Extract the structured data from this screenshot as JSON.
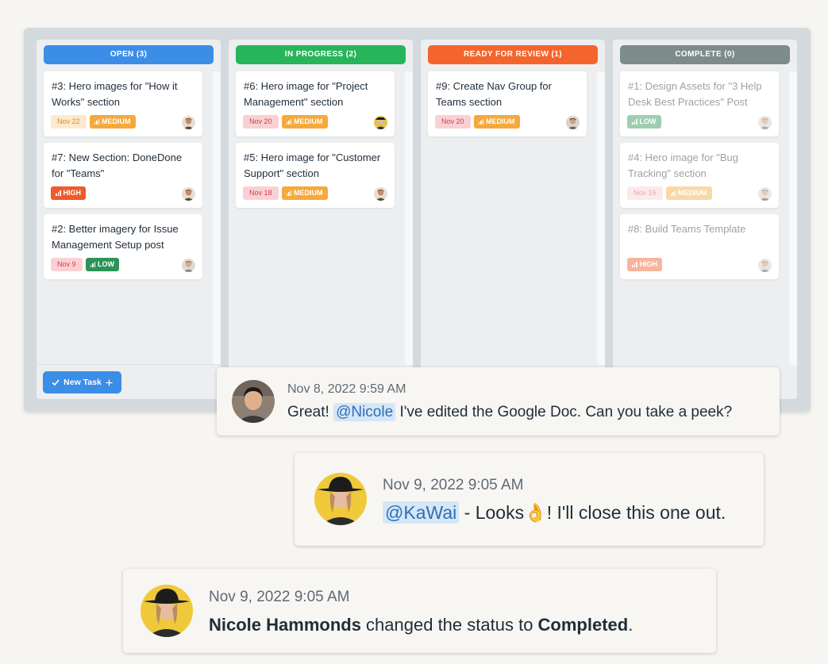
{
  "board": {
    "columns": [
      {
        "title": "OPEN (3)",
        "color": "#3b8de6",
        "cards": [
          {
            "title": "#3: Hero images for \"How it Works\" section",
            "date": "Nov 22",
            "priority": "MEDIUM"
          },
          {
            "title": "#7: New Section: DoneDone for \"Teams\"",
            "date": "",
            "priority": "HIGH"
          },
          {
            "title": "#2: Better imagery for Issue Management Setup post",
            "date": "Nov 9",
            "priority": "LOW"
          }
        ]
      },
      {
        "title": "IN PROGRESS (2)",
        "color": "#27b45a",
        "cards": [
          {
            "title": "#6: Hero image for \"Project Management\" section",
            "date": "Nov 20",
            "priority": "MEDIUM"
          },
          {
            "title": "#5: Hero image for \"Customer Support\" section",
            "date": "Nov 18",
            "priority": "MEDIUM"
          }
        ]
      },
      {
        "title": "READY FOR REVIEW (1)",
        "color": "#f4652d",
        "cards": [
          {
            "title": "#9: Create Nav Group for Teams section",
            "date": "Nov 20",
            "priority": "MEDIUM"
          }
        ]
      },
      {
        "title": "COMPLETE (0)",
        "color": "#7d8b8a",
        "cards": [
          {
            "title": "#1: Design Assets for \"3 Help Desk Best Practices\" Post",
            "date": "",
            "priority": "LOW"
          },
          {
            "title": "#4: Hero image for \"Bug Tracking\" section",
            "date": "Nov 16",
            "priority": "MEDIUM"
          },
          {
            "title": "#8: Build Teams Template",
            "date": "",
            "priority": "HIGH"
          }
        ]
      }
    ],
    "new_task_label": "New Task"
  },
  "comments": [
    {
      "timestamp": "Nov 8, 2022 9:59 AM",
      "before": "Great! ",
      "mention": "@Nicole",
      "after": " I've edited the Google Doc. Can you take a peek?"
    },
    {
      "timestamp": "Nov 9, 2022 9:05 AM",
      "mention": "@KaWai",
      "after": " - Looks",
      "emoji": "👌",
      "after2": "! I'll close this one out."
    },
    {
      "timestamp": "Nov 9, 2022 9:05 AM",
      "name": "Nicole Hammonds",
      "middle": " changed the status to ",
      "status": "Completed",
      "end": "."
    }
  ]
}
